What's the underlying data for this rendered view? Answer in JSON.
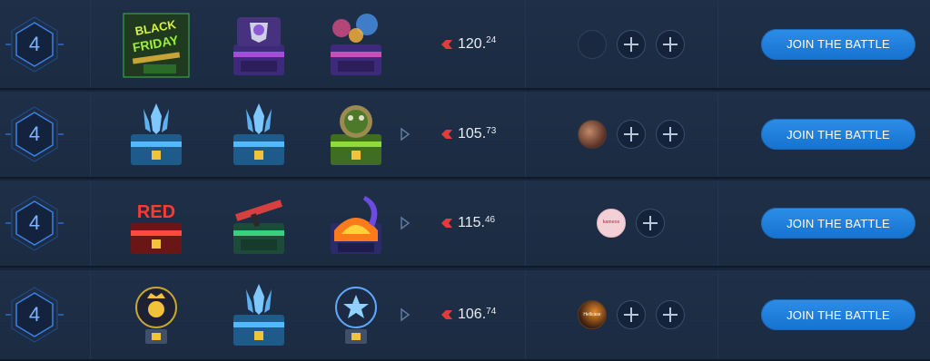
{
  "rows": [
    {
      "players": "4",
      "cases": [
        "black-friday-case",
        "purple-crest-case",
        "fireworks-case"
      ],
      "has_arrow": false,
      "price_int": "120.",
      "price_dec": "24",
      "slots": [
        "empty",
        "plus",
        "plus"
      ],
      "join_label": "JOIN THE BATTLE"
    },
    {
      "players": "4",
      "cases": [
        "trident-case",
        "trident-case",
        "cookie-monster-case"
      ],
      "has_arrow": true,
      "price_int": "105.",
      "price_dec": "73",
      "slots": [
        "avatar",
        "plus",
        "plus"
      ],
      "join_label": "JOIN THE BATTLE"
    },
    {
      "players": "4",
      "cases": [
        "red-case",
        "ak-green-case",
        "fire-knife-case"
      ],
      "has_arrow": true,
      "price_int": "115.",
      "price_dec": "46",
      "slots": [
        "avatar",
        "plus"
      ],
      "join_label": "JOIN THE BATTLE"
    },
    {
      "players": "4",
      "cases": [
        "gold-skull-orb-case",
        "trident-case",
        "blue-star-orb-case"
      ],
      "has_arrow": true,
      "price_int": "106.",
      "price_dec": "74",
      "slots": [
        "avatar",
        "plus",
        "plus"
      ],
      "join_label": "JOIN THE BATTLE"
    }
  ],
  "avatar_labels": {
    "row2": "kameos",
    "row3": "Hellcase"
  },
  "colors": {
    "accent_blue": "#2c8ee8",
    "coin_red": "#e23b3b",
    "background": "#17253a"
  }
}
